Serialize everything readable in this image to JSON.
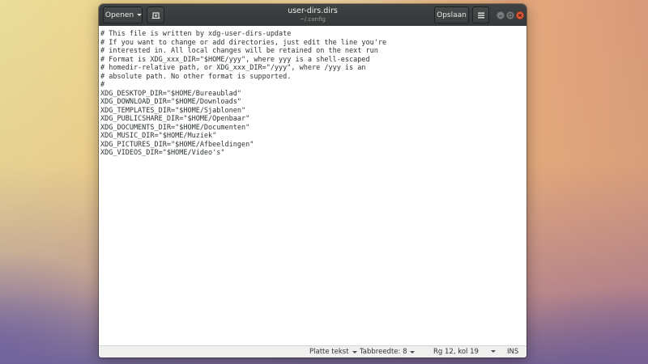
{
  "window": {
    "title": "user-dirs.dirs",
    "subtitle": "~/.config"
  },
  "headerbar": {
    "open_label": "Openen",
    "save_label": "Opslaan"
  },
  "icons": {
    "open_dropdown": "chevron-down-icon",
    "new_tab": "new-document-tab-icon",
    "menu": "hamburger-menu-icon",
    "minimize": "minimize-icon",
    "maximize": "maximize-icon",
    "close": "close-icon"
  },
  "colors": {
    "headerbar": "#393c3d",
    "close_button": "#e05a3a",
    "editor_text": "#2e3436",
    "statusbar": "#f0f0ee"
  },
  "editor": {
    "lines": [
      "# This file is written by xdg-user-dirs-update",
      "# If you want to change or add directories, just edit the line you're",
      "# interested in. All local changes will be retained on the next run",
      "# Format is XDG_xxx_DIR=\"$HOME/yyy\", where yyy is a shell-escaped",
      "# homedir-relative path, or XDG_xxx_DIR=\"/yyy\", where /yyy is an",
      "# absolute path. No other format is supported.",
      "#",
      "XDG_DESKTOP_DIR=\"$HOME/Bureaublad\"",
      "XDG_DOWNLOAD_DIR=\"$HOME/Downloads\"",
      "XDG_TEMPLATES_DIR=\"$HOME/Sjablonen\"",
      "XDG_PUBLICSHARE_DIR=\"$HOME/Openbaar\"",
      "XDG_DOCUMENTS_DIR=\"$HOME/Documenten\"",
      "XDG_MUSIC_DIR=\"$HOME/Muziek\"",
      "XDG_PICTURES_DIR=\"$HOME/Afbeeldingen\"",
      "XDG_VIDEOS_DIR=\"$HOME/Video's\""
    ]
  },
  "statusbar": {
    "language": "Platte tekst",
    "tab_width": "Tabbreedte: 8",
    "cursor_position": "Rg 12, kol 19",
    "insert_mode": "INS"
  }
}
